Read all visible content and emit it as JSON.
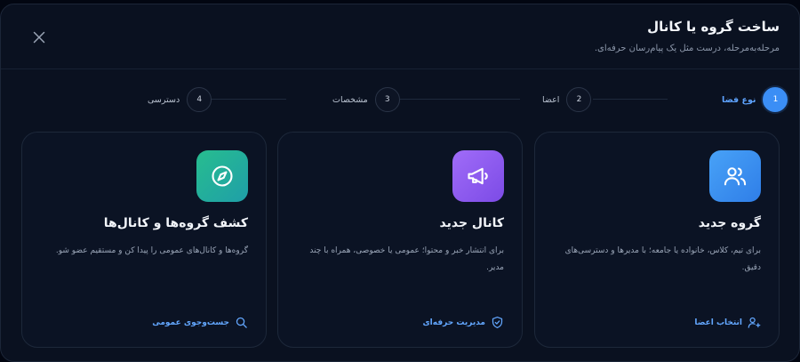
{
  "dialog": {
    "title": "ساخت گروه یا کانال",
    "subtitle": "مرحله‌به‌مرحله، درست مثل یک پیام‌رسان حرفه‌ای."
  },
  "steps": [
    {
      "number": "1",
      "label": "نوع فضا",
      "active": true
    },
    {
      "number": "2",
      "label": "اعضا",
      "active": false
    },
    {
      "number": "3",
      "label": "مشخصات",
      "active": false
    },
    {
      "number": "4",
      "label": "دسترسی",
      "active": false
    }
  ],
  "cards": [
    {
      "title": "گروه جدید",
      "description": "برای تیم، کلاس، خانواده یا جامعه؛ با مدیرها و دسترسی‌های دقیق.",
      "action_label": "انتخاب اعضا",
      "icon": "users-icon",
      "action_icon": "user-plus-icon",
      "color": "#3c8cf0"
    },
    {
      "title": "کانال جدید",
      "description": "برای انتشار خبر و محتوا؛ عمومی یا خصوصی، همراه با چند مدیر.",
      "action_label": "مدیریت حرفه‌ای",
      "icon": "megaphone-icon",
      "action_icon": "shield-check-icon",
      "color": "#8b5cf6"
    },
    {
      "title": "کشف گروه‌ها و کانال‌ها",
      "description": "گروه‌ها و کانال‌های عمومی را پیدا کن و مستقیم عضو شو.",
      "action_label": "جست‌وجوی عمومی",
      "icon": "compass-icon",
      "action_icon": "search-icon",
      "color": "#22b39a"
    }
  ],
  "colors": {
    "background": "#0a1120",
    "accent": "#3b8ef5",
    "link": "#63a7ff"
  }
}
